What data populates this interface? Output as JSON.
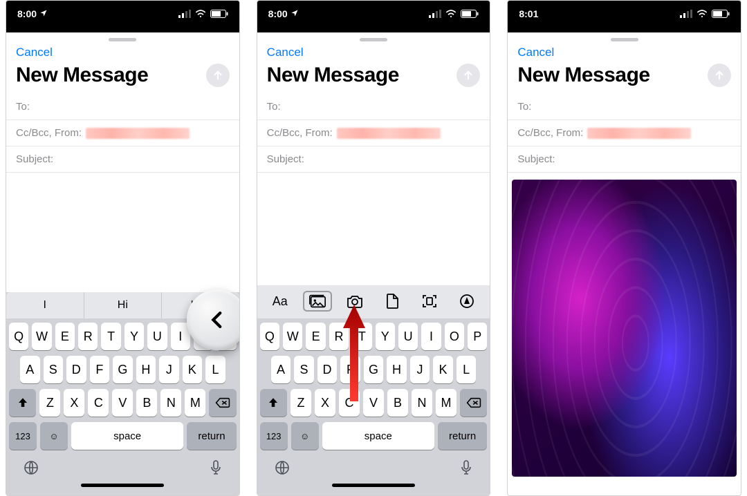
{
  "status": {
    "time_a": "8:00",
    "time_b": "8:00",
    "time_c": "8:01",
    "location_indicator": "↗",
    "signal_label": "signal",
    "wifi_label": "wifi",
    "battery_label": "battery"
  },
  "compose": {
    "cancel": "Cancel",
    "title": "New Message",
    "to_label": "To:",
    "ccbcc_label": "Cc/Bcc, From:",
    "subject_label": "Subject:"
  },
  "suggestions": [
    "I",
    "Hi",
    "Hey"
  ],
  "toolbar": {
    "format_label": "Aa",
    "photos_icon": "photo-library-icon",
    "camera_icon": "camera-icon",
    "document_icon": "document-icon",
    "scan_icon": "scan-icon",
    "markup_icon": "markup-icon"
  },
  "keyboard": {
    "row1": [
      "Q",
      "W",
      "E",
      "R",
      "T",
      "Y",
      "U",
      "I",
      "O",
      "P"
    ],
    "row2": [
      "A",
      "S",
      "D",
      "F",
      "G",
      "H",
      "J",
      "K",
      "L"
    ],
    "row3": [
      "Z",
      "X",
      "C",
      "V",
      "B",
      "N",
      "M"
    ],
    "numkey": "123",
    "space": "space",
    "return": "return"
  },
  "annotations": {
    "callout_chevron": "expand-toolbar-chevron",
    "arrow_target": "photo-library-button"
  }
}
